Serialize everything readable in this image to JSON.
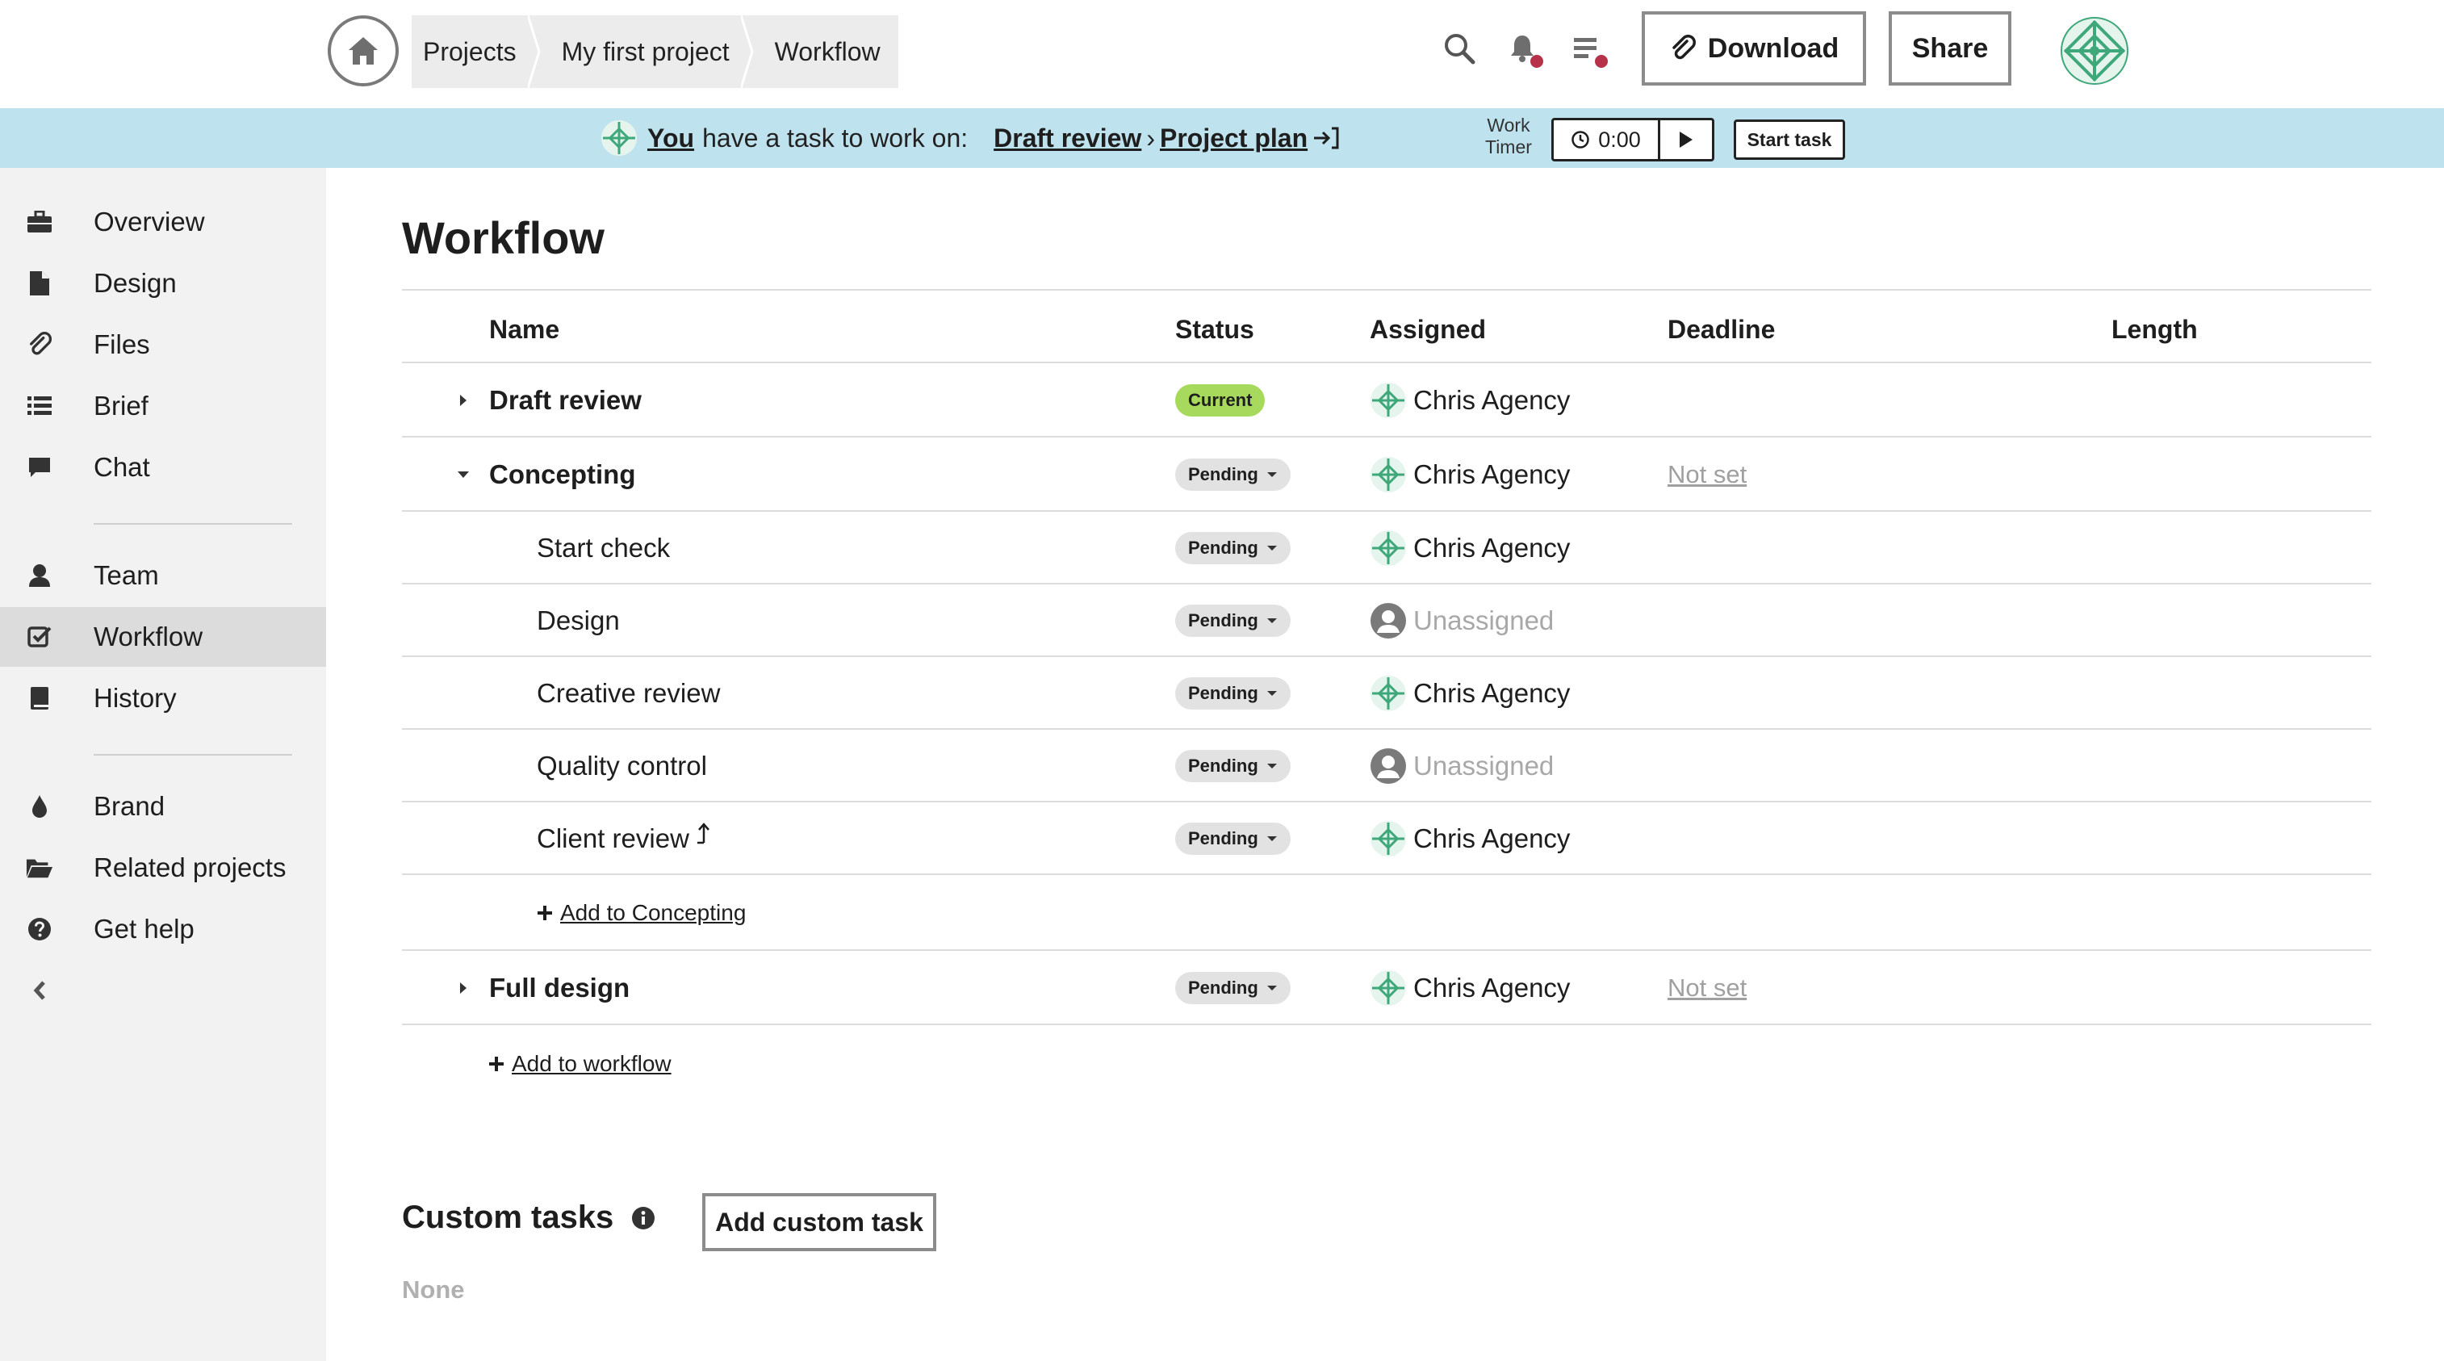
{
  "breadcrumb": {
    "items": [
      "Projects",
      "My first project",
      "Workflow"
    ]
  },
  "header": {
    "download_label": "Download",
    "share_label": "Share",
    "icons": [
      "home-icon",
      "search-icon",
      "bell-icon",
      "task-list-icon",
      "paperclip-icon"
    ]
  },
  "banner": {
    "you": "You",
    "text": "have a task to work on:",
    "task_stage": "Draft review",
    "separator": "›",
    "task_name": "Project plan",
    "timer_label_1": "Work",
    "timer_label_2": "Timer",
    "timer_value": "0:00",
    "start_task_label": "Start task"
  },
  "sidebar": {
    "items": [
      {
        "label": "Overview",
        "icon": "briefcase-icon"
      },
      {
        "label": "Design",
        "icon": "file-icon"
      },
      {
        "label": "Files",
        "icon": "paperclip-icon"
      },
      {
        "label": "Brief",
        "icon": "list-icon"
      },
      {
        "label": "Chat",
        "icon": "chat-icon"
      },
      {
        "label": "Team",
        "icon": "user-icon"
      },
      {
        "label": "Workflow",
        "icon": "checkbox-icon",
        "active": true
      },
      {
        "label": "History",
        "icon": "book-icon"
      },
      {
        "label": "Brand",
        "icon": "droplet-icon"
      },
      {
        "label": "Related projects",
        "icon": "folder-open-icon"
      },
      {
        "label": "Get help",
        "icon": "help-icon"
      }
    ],
    "collapse_icon": "chevron-left-icon"
  },
  "main": {
    "title": "Workflow",
    "columns": {
      "name": "Name",
      "status": "Status",
      "assigned": "Assigned",
      "deadline": "Deadline",
      "length": "Length"
    },
    "rows": [
      {
        "name": "Draft review",
        "status": "Current",
        "assigned": "Chris Agency",
        "deadline": ""
      },
      {
        "name": "Concepting",
        "status": "Pending",
        "assigned": "Chris Agency",
        "deadline": "Not set"
      },
      {
        "name": "Start check",
        "status": "Pending",
        "assigned": "Chris Agency",
        "deadline": ""
      },
      {
        "name": "Design",
        "status": "Pending",
        "assigned": "Unassigned",
        "deadline": ""
      },
      {
        "name": "Creative review",
        "status": "Pending",
        "assigned": "Chris Agency",
        "deadline": ""
      },
      {
        "name": "Quality control",
        "status": "Pending",
        "assigned": "Unassigned",
        "deadline": ""
      },
      {
        "name": "Client review",
        "status": "Pending",
        "assigned": "Chris Agency",
        "deadline": ""
      },
      {
        "name": "Full design",
        "status": "Pending",
        "assigned": "Chris Agency",
        "deadline": "Not set"
      }
    ],
    "add_to_group_label": "Add to Concepting",
    "add_to_workflow_label": "Add to workflow"
  },
  "custom_tasks": {
    "title": "Custom tasks",
    "add_button_label": "Add custom task",
    "empty_text": "None"
  },
  "colors": {
    "banner_bg": "#bfe3ee",
    "current_badge": "#a7d95c",
    "pending_badge": "#e2e2e2",
    "notification_dot": "#b6324a",
    "sidebar_bg": "#f2f2f2",
    "sidebar_active": "#dcdcdc",
    "avatar_green": "#3fa87a"
  }
}
